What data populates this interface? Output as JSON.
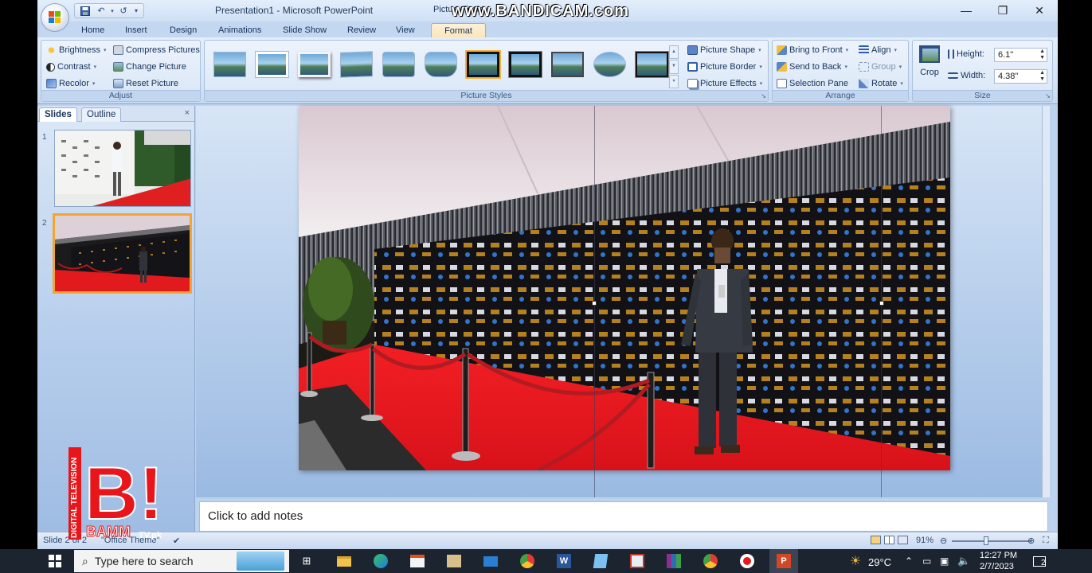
{
  "window": {
    "title": "Presentation1 - Microsoft PowerPoint",
    "context_title": "Picture Tools",
    "minimize": "—",
    "maximize": "❐",
    "close": "✕"
  },
  "watermark": "www.BANDICAM.com",
  "tabs": [
    "Home",
    "Insert",
    "Design",
    "Animations",
    "Slide Show",
    "Review",
    "View",
    "Format"
  ],
  "ribbon": {
    "adjust": {
      "label": "Adjust",
      "brightness": "Brightness",
      "contrast": "Contrast",
      "recolor": "Recolor",
      "compress": "Compress Pictures",
      "change": "Change Picture",
      "reset": "Reset Picture"
    },
    "picture_styles": {
      "label": "Picture Styles",
      "shape": "Picture Shape",
      "border": "Picture Border",
      "effects": "Picture Effects"
    },
    "arrange": {
      "label": "Arrange",
      "bring_front": "Bring to Front",
      "send_back": "Send to Back",
      "selection_pane": "Selection Pane",
      "align": "Align",
      "group": "Group",
      "rotate": "Rotate"
    },
    "size": {
      "label": "Size",
      "crop": "Crop",
      "height_label": "Height:",
      "height_value": "6.1\"",
      "width_label": "Width:",
      "width_value": "4.38\""
    }
  },
  "panel": {
    "tab_slides": "Slides",
    "tab_outline": "Outline",
    "close": "×",
    "slides": [
      {
        "number": "1",
        "selected": false
      },
      {
        "number": "2",
        "selected": true
      }
    ]
  },
  "notes": {
    "placeholder": "Click to add notes"
  },
  "status": {
    "slide_info": "Slide 2 of 2",
    "theme": "\"Office Theme\"",
    "zoom": "91%"
  },
  "bamm_logo": {
    "side": "DIGITAL TELEVISION",
    "letter": "B!",
    "name": "BAMM",
    "suffix": "TV.pk"
  },
  "taskbar": {
    "search_placeholder": "Type here to search",
    "temperature": "29°C",
    "time": "12:27 PM",
    "date": "2/7/2023",
    "notification_count": "2"
  },
  "colors": {
    "ribbon_bg": "#dbe7f7",
    "active_tab": "#fde5b8",
    "red_carpet": "#e8161b",
    "taskbar": "#1c2430"
  },
  "icons": [
    "office-button-icon",
    "save-icon",
    "undo-icon",
    "redo-icon",
    "search-icon",
    "windows-start-icon"
  ]
}
